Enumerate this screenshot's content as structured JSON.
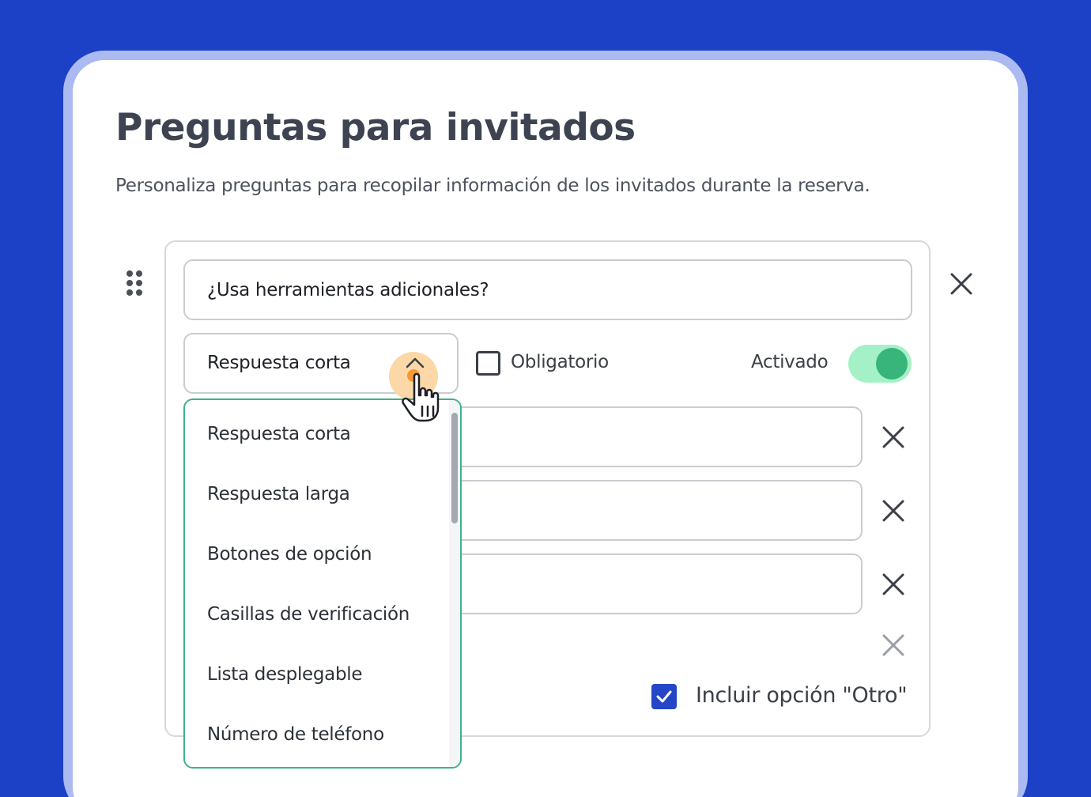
{
  "page": {
    "title": "Preguntas para invitados",
    "subtitle": "Personaliza preguntas para recopilar información de los invitados durante la reserva."
  },
  "question": {
    "text": "¿Usa herramientas adicionales?",
    "type_selected": "Respuesta corta",
    "required_label": "Obligatorio",
    "required_checked": false,
    "enabled_label": "Activado",
    "enabled": true,
    "include_other_label": "Incluir opción \"Otro\"",
    "include_other_checked": true
  },
  "dropdown": {
    "options": [
      "Respuesta corta",
      "Respuesta larga",
      "Botones de opción",
      "Casillas de verificación",
      "Lista desplegable",
      "Número de teléfono"
    ]
  },
  "icons": {
    "drag": "drag-handle-icon",
    "remove": "close-icon",
    "chevron": "chevron-up-icon",
    "cursor": "hand-pointer-icon",
    "check": "checkmark-icon"
  },
  "colors": {
    "background": "#1c40c6",
    "card_border": "#abbaf0",
    "toggle_on": "#37b57a",
    "toggle_track": "#a5f1c7",
    "dropdown_border": "#3fb28a",
    "checkbox_checked": "#2446c7",
    "halo": "#fcd8a8",
    "cursor_dot": "#f79a33"
  }
}
